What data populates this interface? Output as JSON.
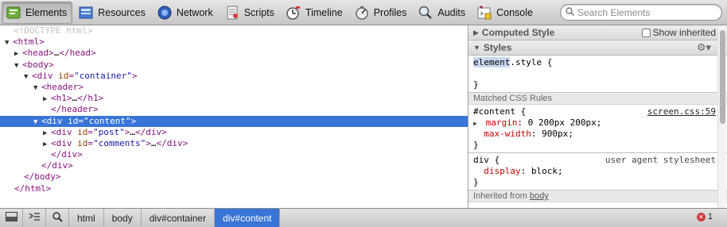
{
  "toolbar": {
    "tabs": [
      {
        "label": "Elements",
        "icon": "elements-icon",
        "active": true
      },
      {
        "label": "Resources",
        "icon": "resources-icon"
      },
      {
        "label": "Network",
        "icon": "network-icon"
      },
      {
        "label": "Scripts",
        "icon": "scripts-icon"
      },
      {
        "label": "Timeline",
        "icon": "timeline-icon"
      },
      {
        "label": "Profiles",
        "icon": "profiles-icon"
      },
      {
        "label": "Audits",
        "icon": "audits-icon"
      },
      {
        "label": "Console",
        "icon": "console-icon"
      }
    ],
    "search_placeholder": "Search Elements"
  },
  "dom": {
    "doctype": "<!DOCTYPE html>",
    "html_tag": "html",
    "head_tag": "head",
    "body_tag": "body",
    "div_tag": "div",
    "header_tag": "header",
    "h1_tag": "h1",
    "id_attr": "id",
    "container_val": "\"container\"",
    "content_val": "\"content\"",
    "post_val": "\"post\"",
    "comments_val": "\"comments\"",
    "ellipsis": "…"
  },
  "styles": {
    "computed_title": "Computed Style",
    "show_inherited": "Show inherited",
    "styles_title": "Styles",
    "element_style_selector": "element",
    "element_style_rest": ".style {",
    "close_brace": "}",
    "matched_title": "Matched CSS Rules",
    "rule1": {
      "selector": "#content {",
      "source": "screen.css:59",
      "props": [
        {
          "name": "margin",
          "value": "0 200px 200px;"
        },
        {
          "name": "max-width",
          "value": "900px;"
        }
      ]
    },
    "rule2": {
      "selector": "div {",
      "source": "user agent stylesheet",
      "props": [
        {
          "name": "display",
          "value": "block;"
        }
      ]
    },
    "inherited_prefix": "Inherited from ",
    "inherited_from": "body"
  },
  "statusbar": {
    "breadcrumbs": [
      "html",
      "body",
      "div#container",
      "div#content"
    ],
    "error_count": "1"
  },
  "colors": {
    "selection": "#3875d7",
    "tag": "#881280",
    "attribute": "#994500",
    "value": "#1a1aa6",
    "css_property": "#c80000"
  }
}
